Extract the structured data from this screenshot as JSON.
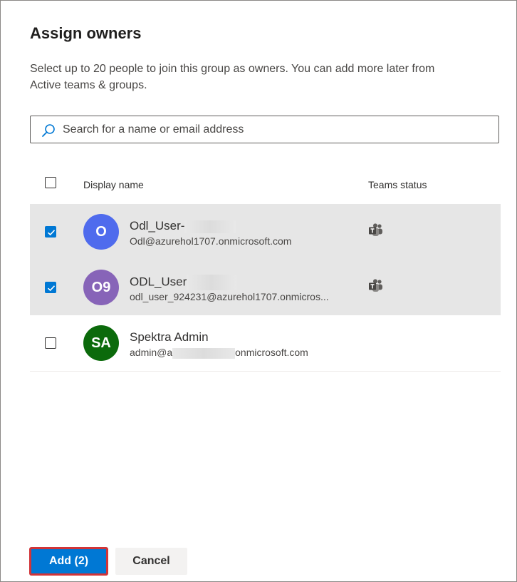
{
  "dialog": {
    "title": "Assign owners",
    "description_line1": "Select up to 20 people to join this group as owners. You can add more later from",
    "description_line2": "Active teams & groups."
  },
  "search": {
    "placeholder": "Search for a name or email address",
    "icon": "search-icon"
  },
  "table": {
    "headers": {
      "display_name": "Display name",
      "teams_status": "Teams status"
    },
    "rows": [
      {
        "name": "Odl_User-",
        "email": "Odl@azurehol1707.onmicrosoft.com",
        "initials": "O",
        "avatar_color": "#4f6bed",
        "checked": true,
        "teams_icon": "teams-icon"
      },
      {
        "name": "ODL_User",
        "email": "odl_user_924231@azurehol1707.onmicros...",
        "initials": "O9",
        "avatar_color": "#8764b8",
        "checked": true,
        "teams_icon": "teams-icon"
      },
      {
        "name": "Spektra Admin",
        "email_prefix": "admin@a",
        "email_suffix": "onmicrosoft.com",
        "initials": "SA",
        "avatar_color": "#0b6a0b",
        "checked": false
      }
    ]
  },
  "buttons": {
    "add_label": "Add (2)",
    "cancel_label": "Cancel"
  },
  "colors": {
    "accent": "#0078d4",
    "highlight_border": "#d13438",
    "selected_row": "#e6e6e6"
  }
}
